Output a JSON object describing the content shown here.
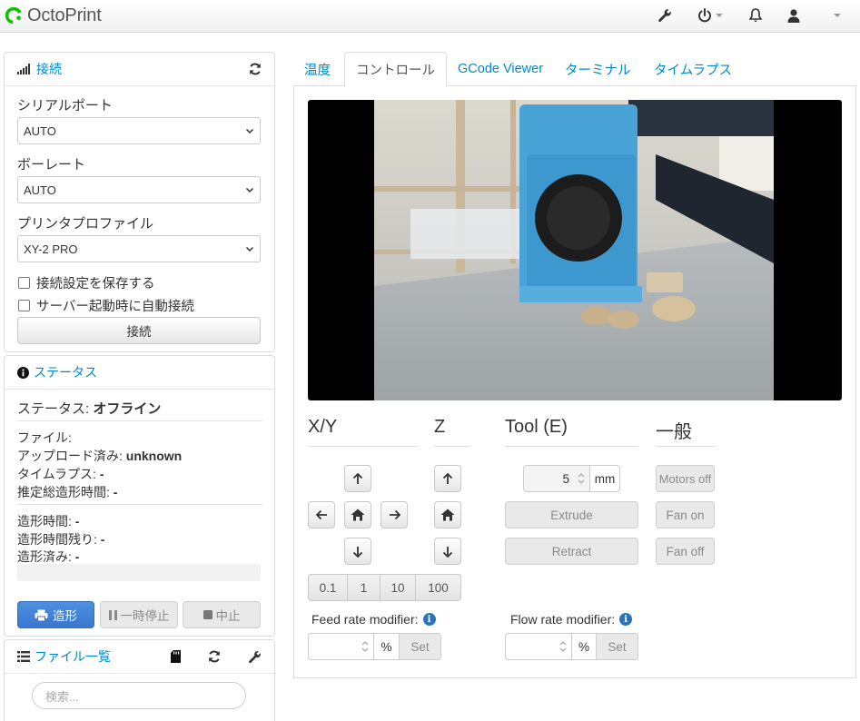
{
  "navbar": {
    "brand": "OctoPrint",
    "icons": [
      "wrench-icon",
      "power-icon",
      "bell-icon",
      "user-icon",
      "caret-down-icon"
    ]
  },
  "connection": {
    "title": "接続",
    "serial_port_label": "シリアルポート",
    "serial_port_value": "AUTO",
    "baudrate_label": "ボーレート",
    "baudrate_value": "AUTO",
    "profile_label": "プリンタプロファイル",
    "profile_value": "XY-2 PRO",
    "save_settings_label": "接続設定を保存する",
    "auto_connect_label": "サーバー起動時に自動接続",
    "connect_button": "接続"
  },
  "state": {
    "title": "ステータス",
    "status_label": "ステータス:",
    "status_value": "オフライン",
    "file_label": "ファイル:",
    "uploaded_label": "アップロード済み:",
    "uploaded_value": "unknown",
    "timelapse_label": "タイムラプス:",
    "timelapse_value": "-",
    "est_time_label": "推定総造形時間:",
    "est_time_value": "-",
    "print_time_label": "造形時間:",
    "print_time_value": "-",
    "time_left_label": "造形時間残り:",
    "time_left_value": "-",
    "printed_label": "造形済み:",
    "printed_value": "-",
    "progress": 0,
    "print_button": "造形",
    "pause_button": "一時停止",
    "cancel_button": "中止"
  },
  "files": {
    "title": "ファイル一覧",
    "search_placeholder": "検索..."
  },
  "tabs": [
    {
      "label": "温度",
      "active": false
    },
    {
      "label": "コントロール",
      "active": true
    },
    {
      "label": "GCode Viewer",
      "active": false
    },
    {
      "label": "ターミナル",
      "active": false
    },
    {
      "label": "タイムラプス",
      "active": false
    }
  ],
  "control": {
    "xy_title": "X/Y",
    "z_title": "Z",
    "tool_title": "Tool (E)",
    "general_title": "一般",
    "step_sizes": [
      "0.1",
      "1",
      "10",
      "100"
    ],
    "extrude_amount": "5",
    "extrude_unit": "mm",
    "extrude_button": "Extrude",
    "retract_button": "Retract",
    "motors_off": "Motors off",
    "fan_on": "Fan on",
    "fan_off": "Fan off",
    "feed_rate_label": "Feed rate modifier:",
    "flow_rate_label": "Flow rate modifier:",
    "percent": "%",
    "set_button": "Set"
  },
  "colors": {
    "link": "#0088cc",
    "primary_button": "#428bca",
    "brand_green": "#13c100"
  }
}
